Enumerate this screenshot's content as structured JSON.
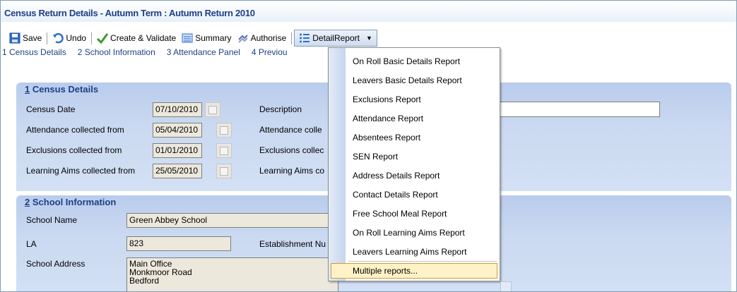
{
  "window": {
    "title": "Census Return Details - Autumn Term : Autumn Return 2010"
  },
  "toolbar": {
    "save_label": "Save",
    "undo_label": "Undo",
    "create_validate_label": "Create & Validate",
    "summary_label": "Summary",
    "authorise_label": "Authorise",
    "detail_report_label": "DetailReport"
  },
  "nav": {
    "links": [
      "1 Census Details",
      "2 School Information",
      "3 Attendance Panel",
      "4 Previou"
    ]
  },
  "census_details": {
    "heading_number": "1",
    "heading_text": " Census Details",
    "rows": [
      {
        "label": "Census Date",
        "value": "07/10/2010",
        "right_label": "Description"
      },
      {
        "label": "Attendance collected from",
        "value": "05/04/2010",
        "right_label": "Attendance colle"
      },
      {
        "label": "Exclusions collected from",
        "value": "01/01/2010",
        "right_label": "Exclusions collec"
      },
      {
        "label": "Learning Aims collected from",
        "value": "25/05/2010",
        "right_label": "Learning Aims co"
      }
    ]
  },
  "school_info": {
    "heading_number": "2",
    "heading_text": " School Information",
    "school_name_label": "School Name",
    "school_name_value": "Green Abbey School",
    "la_label": "LA",
    "la_value": "823",
    "establishment_label": "Establishment Nu",
    "address_label": "School Address",
    "address_lines": [
      "Main Office",
      "Monkmoor Road",
      "Bedford"
    ]
  },
  "report_menu": {
    "items": [
      "On Roll Basic Details Report",
      "Leavers Basic Details Report",
      "Exclusions Report",
      "Attendance Report",
      "Absentees Report",
      "SEN Report",
      "Address Details Report",
      "Contact Details Report",
      "Free School Meal Report",
      "On Roll Learning Aims Report",
      "Leavers Learning Aims Report"
    ],
    "highlighted_item": "Multiple reports..."
  },
  "colors": {
    "title_text": "#1f3f86",
    "panel_bg": "#cad9f1",
    "field_bg": "#ece8dc",
    "menu_highlight": "#fff2c6"
  }
}
